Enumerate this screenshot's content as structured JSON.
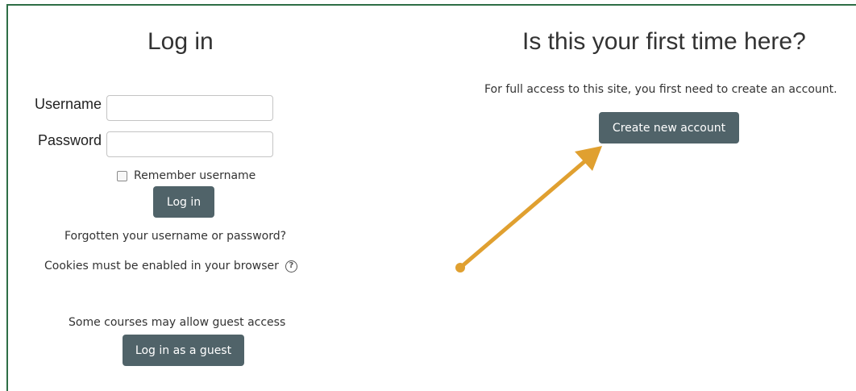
{
  "login": {
    "heading": "Log in",
    "username_label": "Username",
    "username_value": "",
    "password_label": "Password",
    "password_value": "",
    "remember_label": "Remember username",
    "remember_checked": false,
    "login_button": "Log in",
    "forgot_link": "Forgotten your username or password?",
    "cookies_note": "Cookies must be enabled in your browser",
    "help_icon": "?",
    "guest_note": "Some courses may allow guest access",
    "guest_button": "Log in as a guest"
  },
  "signup": {
    "heading": "Is this your first time here?",
    "access_note": "For full access to this site, you first need to create an account.",
    "create_button": "Create new account"
  },
  "annotation": {
    "arrow_color": "#e0a030",
    "icon": "arrow-annotation"
  },
  "colors": {
    "button_bg": "#506369",
    "frame_border": "#2e6e46"
  }
}
